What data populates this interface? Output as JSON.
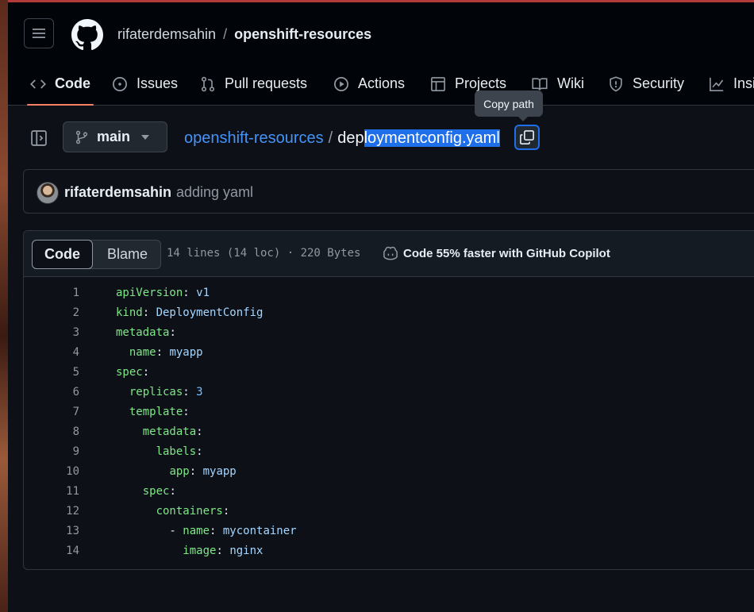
{
  "header": {
    "owner": "rifaterdemsahin",
    "separator": "/",
    "repo": "openshift-resources"
  },
  "tabs": [
    {
      "label": "Code",
      "icon": "code-icon"
    },
    {
      "label": "Issues",
      "icon": "issue-opened-icon"
    },
    {
      "label": "Pull requests",
      "icon": "git-pull-request-icon"
    },
    {
      "label": "Actions",
      "icon": "play-icon"
    },
    {
      "label": "Projects",
      "icon": "table-icon"
    },
    {
      "label": "Wiki",
      "icon": "book-icon"
    },
    {
      "label": "Security",
      "icon": "shield-icon"
    },
    {
      "label": "Insi",
      "icon": "graph-icon"
    }
  ],
  "tooltip": "Copy path",
  "branch": "main",
  "breadcrumb": {
    "repo_link": "openshift-resources",
    "separator": "/",
    "file_prefix": "dep",
    "file_selected": "loymentconfig.yaml"
  },
  "commit": {
    "author": "rifaterdemsahin",
    "message": "adding yaml"
  },
  "file_header": {
    "code_tab": "Code",
    "blame_tab": "Blame",
    "stats": "14 lines (14 loc) · 220 Bytes",
    "copilot": "Code 55% faster with GitHub Copilot"
  },
  "code_lines": [
    {
      "num": "1",
      "indent": "",
      "key": "apiVersion",
      "colon": ": ",
      "value": "v1",
      "vtype": "v"
    },
    {
      "num": "2",
      "indent": "",
      "key": "kind",
      "colon": ": ",
      "value": "DeploymentConfig",
      "vtype": "v"
    },
    {
      "num": "3",
      "indent": "",
      "key": "metadata",
      "colon": ":",
      "value": "",
      "vtype": "v"
    },
    {
      "num": "4",
      "indent": "  ",
      "key": "name",
      "colon": ": ",
      "value": "myapp",
      "vtype": "v"
    },
    {
      "num": "5",
      "indent": "",
      "key": "spec",
      "colon": ":",
      "value": "",
      "vtype": "v"
    },
    {
      "num": "6",
      "indent": "  ",
      "key": "replicas",
      "colon": ": ",
      "value": "3",
      "vtype": "n"
    },
    {
      "num": "7",
      "indent": "  ",
      "key": "template",
      "colon": ":",
      "value": "",
      "vtype": "v"
    },
    {
      "num": "8",
      "indent": "    ",
      "key": "metadata",
      "colon": ":",
      "value": "",
      "vtype": "v"
    },
    {
      "num": "9",
      "indent": "      ",
      "key": "labels",
      "colon": ":",
      "value": "",
      "vtype": "v"
    },
    {
      "num": "10",
      "indent": "        ",
      "key": "app",
      "colon": ": ",
      "value": "myapp",
      "vtype": "v"
    },
    {
      "num": "11",
      "indent": "    ",
      "key": "spec",
      "colon": ":",
      "value": "",
      "vtype": "v"
    },
    {
      "num": "12",
      "indent": "      ",
      "key": "containers",
      "colon": ":",
      "value": "",
      "vtype": "v"
    },
    {
      "num": "13",
      "indent": "        - ",
      "key": "name",
      "colon": ": ",
      "value": "mycontainer",
      "vtype": "v"
    },
    {
      "num": "14",
      "indent": "          ",
      "key": "image",
      "colon": ": ",
      "value": "nginx",
      "vtype": "v"
    }
  ]
}
